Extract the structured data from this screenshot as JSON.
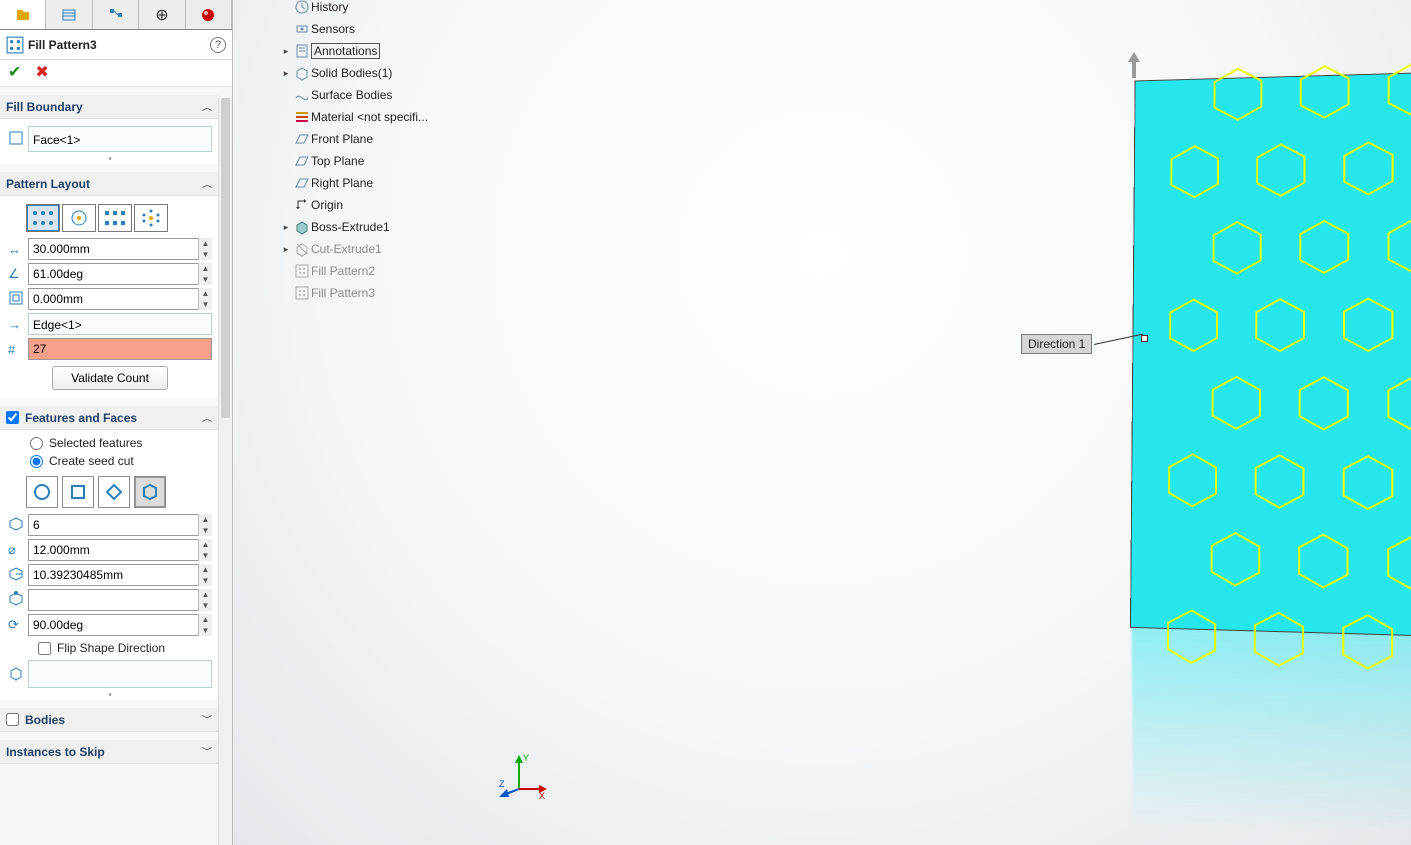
{
  "feature": {
    "name": "Fill Pattern3"
  },
  "sections": {
    "fill_boundary": {
      "title": "Fill Boundary",
      "face": "Face<1>"
    },
    "pattern_layout": {
      "title": "Pattern Layout",
      "spacing": "30.000mm",
      "angle": "61.00deg",
      "margin": "0.000mm",
      "direction": "Edge<1>",
      "instances": "27",
      "validate": "Validate Count"
    },
    "features_faces": {
      "title": "Features and Faces",
      "checked": true,
      "radio_selected": "Selected features",
      "radio_create": "Create seed cut",
      "sides": "6",
      "diameter": "12.000mm",
      "inner": "10.39230485mm",
      "blank": "",
      "rotation": "90.00deg",
      "flip": "Flip Shape Direction",
      "body_sel": ""
    },
    "bodies": {
      "title": "Bodies"
    },
    "skip": {
      "title": "Instances to Skip"
    }
  },
  "tree": {
    "items": [
      {
        "label": "History",
        "icon": "clock"
      },
      {
        "label": "Sensors",
        "icon": "sensor"
      },
      {
        "label": "Annotations",
        "icon": "note",
        "boxed": true,
        "expand": true
      },
      {
        "label": "Solid Bodies(1)",
        "icon": "solid",
        "expand": true
      },
      {
        "label": "Surface Bodies",
        "icon": "surface"
      },
      {
        "label": "Material <not specifi...",
        "icon": "material"
      },
      {
        "label": "Front Plane",
        "icon": "plane"
      },
      {
        "label": "Top Plane",
        "icon": "plane"
      },
      {
        "label": "Right Plane",
        "icon": "plane"
      },
      {
        "label": "Origin",
        "icon": "origin"
      },
      {
        "label": "Boss-Extrude1",
        "icon": "extrude",
        "expand": true
      },
      {
        "label": "Cut-Extrude1",
        "icon": "cut",
        "ghost": true,
        "expand": true
      },
      {
        "label": "Fill Pattern2",
        "icon": "fill",
        "ghost": true
      },
      {
        "label": "Fill Pattern3",
        "icon": "fill",
        "ghost": true
      }
    ]
  },
  "callout": {
    "label": "Direction 1"
  },
  "triad": {
    "x": "X",
    "y": "Y",
    "z": "Z"
  }
}
